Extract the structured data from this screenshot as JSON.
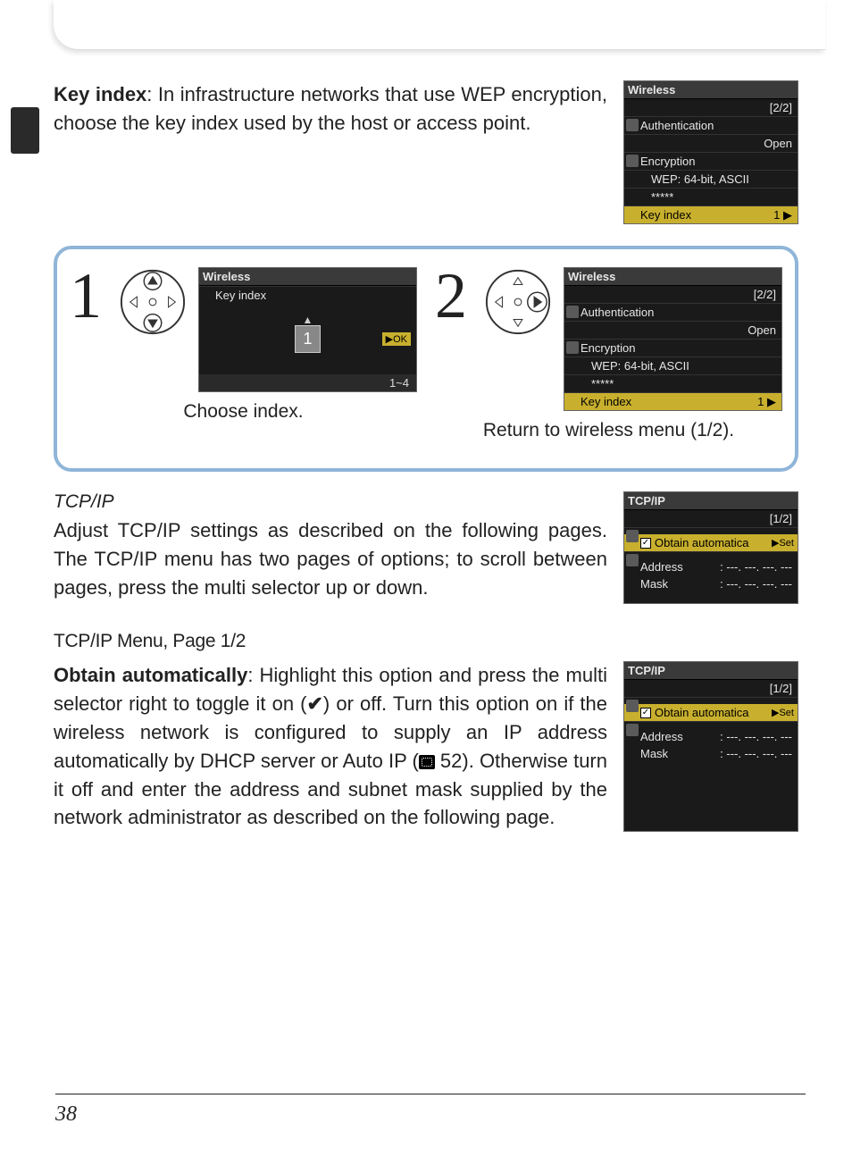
{
  "page_number": "38",
  "key_index": {
    "label": "Key index",
    "description": ": In infrastructure networks that use WEP encryption, choose the key index used by the host or access point.",
    "lcd": {
      "title": "Wireless",
      "page": "[2/2]",
      "auth_label": "Authentication",
      "auth_value": "Open",
      "enc_label": "Encryption",
      "enc_value": "WEP: 64-bit, ASCII",
      "enc_key": "*****",
      "ki_label": "Key index",
      "ki_value": "1",
      "arrow": "▶"
    }
  },
  "steps": {
    "step1": {
      "num": "1",
      "caption": "Choose index.",
      "lcd": {
        "title": "Wireless",
        "subtitle": "Key index",
        "value": "1",
        "ok": "▶OK",
        "range": "1~4"
      }
    },
    "step2": {
      "num": "2",
      "caption": "Return to wireless menu (1/2).",
      "lcd": {
        "title": "Wireless",
        "page": "[2/2]",
        "auth_label": "Authentication",
        "auth_value": "Open",
        "enc_label": "Encryption",
        "enc_value": "WEP: 64-bit, ASCII",
        "enc_key": "*****",
        "ki_label": "Key index",
        "ki_value": "1",
        "arrow": "▶"
      }
    }
  },
  "tcpip": {
    "heading": "TCP/IP",
    "body": "Adjust TCP/IP settings as described on the following pages. The TCP/IP menu has two pages of options; to scroll between pages, press the multi selector up or down.",
    "lcd": {
      "title": "TCP/IP",
      "page": "[1/2]",
      "obtain": "Obtain automatica",
      "set": "▶Set",
      "address_label": "Address",
      "address_value": ": ---. ---. ---. ---",
      "mask_label": "Mask",
      "mask_value": ": ---. ---. ---. ---"
    }
  },
  "tcpip_page_heading": "TCP/IP Menu, Page 1/2",
  "obtain": {
    "label": "Obtain automatically",
    "body_a": ": Highlight this option and press the multi selector right to toggle it on (",
    "check": "✔",
    "body_b": ") or off. Turn this option on if the wireless network is configured to supply an IP address automatically by DHCP server or Auto IP (",
    "page_ref": " 52",
    "body_c": "). Otherwise turn it off and enter the address and subnet mask supplied by the network administrator as described on the following page.",
    "lcd": {
      "title": "TCP/IP",
      "page": "[1/2]",
      "obtain": "Obtain automatica",
      "set": "▶Set",
      "address_label": "Address",
      "address_value": ": ---. ---. ---. ---",
      "mask_label": "Mask",
      "mask_value": ": ---. ---. ---. ---"
    }
  }
}
